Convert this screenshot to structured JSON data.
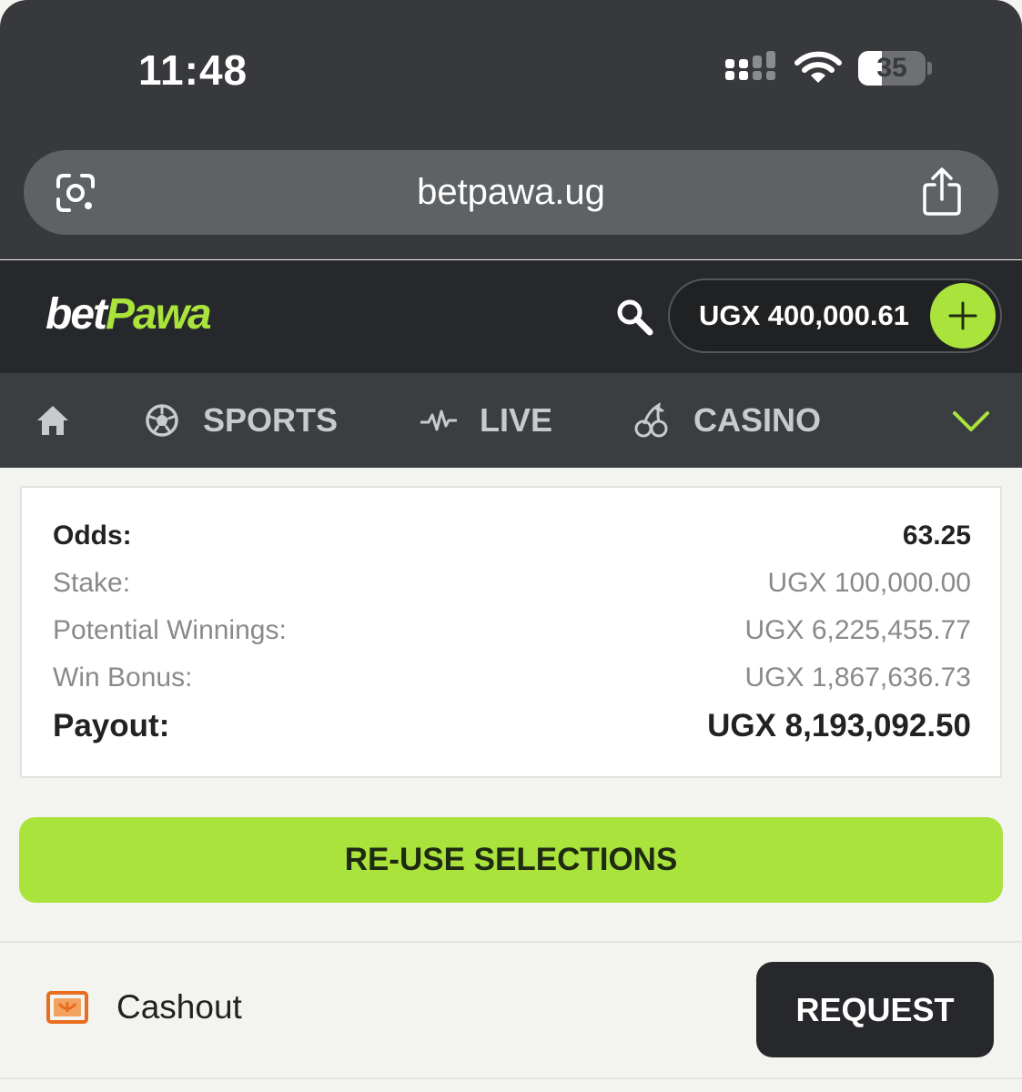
{
  "status_bar": {
    "time": "11:48",
    "battery_level": "35",
    "battery_fraction": 0.35
  },
  "browser": {
    "url": "betpawa.ug",
    "left_icon": "google-lens-icon",
    "right_icon": "share-icon"
  },
  "header": {
    "logo_part1": "bet",
    "logo_part2": "Pawa",
    "balance": "UGX 400,000.61",
    "deposit_icon": "plus-icon",
    "search_icon": "search-icon",
    "accent_color": "#a9e33c"
  },
  "nav": {
    "items": [
      {
        "label": "",
        "icon": "home-icon"
      },
      {
        "label": "SPORTS",
        "icon": "soccer-ball-icon"
      },
      {
        "label": "LIVE",
        "icon": "pulse-icon"
      },
      {
        "label": "CASINO",
        "icon": "cherries-icon"
      }
    ],
    "more_icon": "chevron-down-icon"
  },
  "summary": {
    "odds_label": "Odds:",
    "odds_value": "63.25",
    "stake_label": "Stake:",
    "stake_value": "UGX 100,000.00",
    "winnings_label": "Potential Winnings:",
    "winnings_value": "UGX 6,225,455.77",
    "bonus_label": "Win Bonus:",
    "bonus_value": "UGX 1,867,636.73",
    "payout_label": "Payout:",
    "payout_value": "UGX 8,193,092.50"
  },
  "reuse_button_label": "RE-USE SELECTIONS",
  "cashout": {
    "label": "Cashout",
    "icon": "cashout-icon",
    "button_label": "REQUEST"
  }
}
